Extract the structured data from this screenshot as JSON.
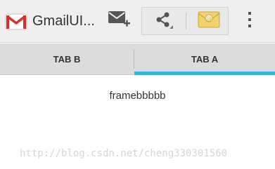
{
  "action_bar": {
    "app_title": "GmailUI...",
    "icons": {
      "app": "gmail-envelope-icon",
      "compose": "compose-mail-icon",
      "share": "share-icon",
      "mail": "mail-envelope-icon",
      "overflow": "overflow-menu-icon"
    }
  },
  "tabs": [
    {
      "label": "TAB B",
      "selected": false
    },
    {
      "label": "TAB A",
      "selected": true
    }
  ],
  "content": {
    "text": "framebbbbb"
  },
  "watermark": "http://blog.csdn.net/cheng330301560",
  "colors": {
    "action_bar_bg": "#efefef",
    "tab_bar_bg": "#dcdcdc",
    "tab_indicator": "#33b5e5",
    "gmail_red": "#d93025"
  }
}
